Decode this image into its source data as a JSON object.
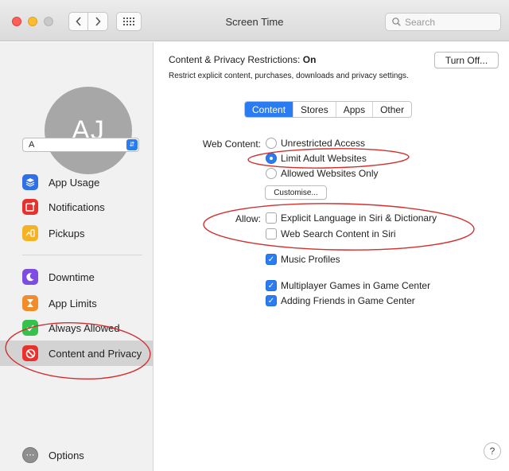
{
  "window": {
    "title": "Screen Time",
    "search_placeholder": "Search"
  },
  "sidebar": {
    "avatar_initials": "AJ",
    "user_select_value": "A",
    "items": [
      {
        "label": "App Usage",
        "icon": "layers-icon",
        "color": "#2f6fe8"
      },
      {
        "label": "Notifications",
        "icon": "notification-icon",
        "color": "#e8312c"
      },
      {
        "label": "Pickups",
        "icon": "pickups-icon",
        "color": "#f5b324"
      },
      {
        "label": "Downtime",
        "icon": "moon-icon",
        "color": "#7c4de0"
      },
      {
        "label": "App Limits",
        "icon": "hourglass-icon",
        "color": "#f18c2a"
      },
      {
        "label": "Always Allowed",
        "icon": "checkmark-icon",
        "color": "#34c14c"
      },
      {
        "label": "Content and Privacy",
        "icon": "no-entry-icon",
        "color": "#e8312c",
        "selected": true
      }
    ],
    "options_label": "Options"
  },
  "main": {
    "restriction_title_prefix": "Content & Privacy Restrictions: ",
    "restriction_status": "On",
    "restriction_description": "Restrict explicit content, purchases, downloads and privacy settings.",
    "turn_off_label": "Turn Off...",
    "tabs": [
      {
        "label": "Content",
        "active": true
      },
      {
        "label": "Stores",
        "active": false
      },
      {
        "label": "Apps",
        "active": false
      },
      {
        "label": "Other",
        "active": false
      }
    ],
    "web_content_label": "Web Content:",
    "web_options": [
      {
        "label": "Unrestricted Access",
        "selected": false
      },
      {
        "label": "Limit Adult Websites",
        "selected": true
      },
      {
        "label": "Allowed Websites Only",
        "selected": false
      }
    ],
    "customise_label": "Customise...",
    "allow_label": "Allow:",
    "allow_options": [
      {
        "label": "Explicit Language in Siri & Dictionary",
        "checked": false
      },
      {
        "label": "Web Search Content in Siri",
        "checked": false
      },
      {
        "label": "Music Profiles",
        "checked": true
      },
      {
        "label": "Multiplayer Games in Game Center",
        "checked": true
      },
      {
        "label": "Adding Friends in Game Center",
        "checked": true
      }
    ],
    "help_label": "?"
  },
  "accent_color": "#2b7cf0",
  "annotation_color": "#d22f2f"
}
